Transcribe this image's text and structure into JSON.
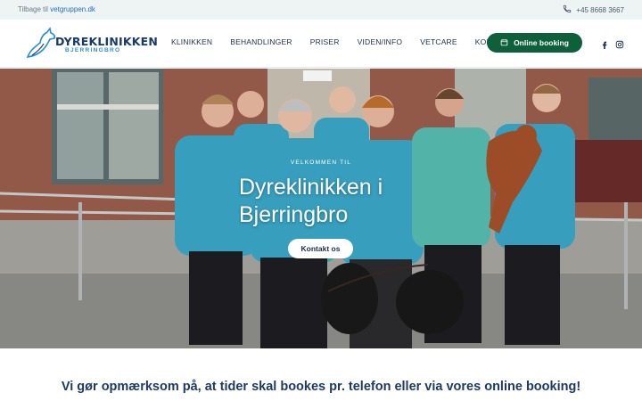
{
  "topbar": {
    "back_prefix": "Tilbage til",
    "back_link": "vetgruppen.dk",
    "phone": "+45 8668 3667"
  },
  "header": {
    "logo_name": "DYREKLINIKKEN",
    "logo_sub": "BJERRINGBRO",
    "nav": [
      {
        "label": "KLINIKKEN"
      },
      {
        "label": "BEHANDLINGER"
      },
      {
        "label": "PRISER"
      },
      {
        "label": "VIDEN/INFO"
      },
      {
        "label": "VETCARE"
      },
      {
        "label": "KONTAKT"
      }
    ],
    "booking_label": "Online booking",
    "booking_icon": "calendar-icon",
    "social": [
      "facebook-icon",
      "instagram-icon"
    ]
  },
  "hero": {
    "eyebrow": "VELKOMMEN TIL",
    "title": "Dyreklinikken i Bjerringbro",
    "cta_label": "Kontakt os"
  },
  "notice": {
    "line1": "Vi gør opmærksom på, at tider skal bookes pr. telefon eller via vores online booking!"
  },
  "colors": {
    "brand_navy": "#183a6b",
    "brand_green": "#0e5f3c",
    "scrubs": "#3aa7c9",
    "topbar_bg": "#eef3f4"
  }
}
